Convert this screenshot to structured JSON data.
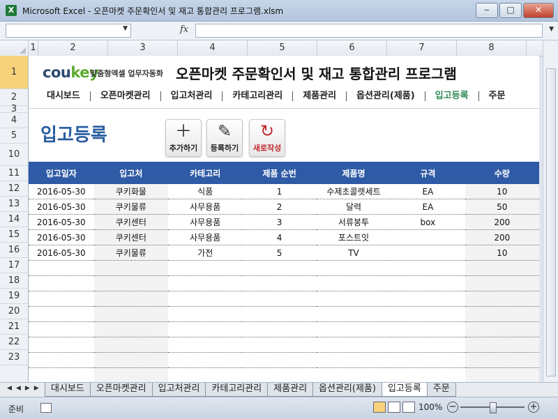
{
  "window": {
    "app_icon": "excel-icon",
    "title": "Microsoft Excel - 오픈마켓 주문확인서 및 재고 통합관리 프로그램.xlsm",
    "btn_minimize": "‒",
    "btn_maximize": "□",
    "btn_close": "✕"
  },
  "formula_bar": {
    "name_box_value": "",
    "fx_label": "fx",
    "formula_value": ""
  },
  "columns": [
    "1",
    "2",
    "3",
    "4",
    "5",
    "6",
    "7",
    "8"
  ],
  "rows": [
    "1",
    "2",
    "3",
    "4",
    "5",
    "10",
    "11",
    "12",
    "13",
    "14",
    "15",
    "16",
    "17",
    "18",
    "19",
    "20",
    "21",
    "22",
    "23"
  ],
  "header": {
    "logo_main": "cou",
    "logo_accent": "key",
    "logo_sub": "맞춤형엑셀 업무자동화",
    "app_title": "오픈마켓 주문확인서 및 재고 통합관리 프로그램"
  },
  "nav": {
    "items": [
      {
        "label": "대시보드",
        "active": false
      },
      {
        "label": "오픈마켓관리",
        "active": false
      },
      {
        "label": "입고처관리",
        "active": false
      },
      {
        "label": "카테고리관리",
        "active": false
      },
      {
        "label": "제품관리",
        "active": false
      },
      {
        "label": "옵션관리(제품)",
        "active": false
      },
      {
        "label": "입고등록",
        "active": true
      },
      {
        "label": "주문",
        "active": false
      }
    ]
  },
  "page": {
    "title": "입고등록",
    "buttons": {
      "add": {
        "label": "추가하기",
        "icon": "plus-icon"
      },
      "register": {
        "label": "등록하기",
        "icon": "pencil-icon"
      },
      "new": {
        "label": "새로작성",
        "icon": "refresh-icon"
      }
    }
  },
  "table": {
    "columns": [
      "입고일자",
      "입고처",
      "카테고리",
      "제품 순번",
      "제품명",
      "규격",
      "수량"
    ],
    "rows": [
      [
        "2016-05-30",
        "쿠키화물",
        "식품",
        "1",
        "수제초콜렛세트",
        "EA",
        "10"
      ],
      [
        "2016-05-30",
        "쿠키물류",
        "사무용품",
        "2",
        "달력",
        "EA",
        "50"
      ],
      [
        "2016-05-30",
        "쿠키센터",
        "사무용품",
        "3",
        "서류봉투",
        "box",
        "200"
      ],
      [
        "2016-05-30",
        "쿠키센터",
        "사무용품",
        "4",
        "포스트잇",
        "",
        "200"
      ],
      [
        "2016-05-30",
        "쿠키물류",
        "가전",
        "5",
        "TV",
        "",
        "10"
      ],
      [
        "",
        "",
        "",
        "",
        "",
        "",
        ""
      ],
      [
        "",
        "",
        "",
        "",
        "",
        "",
        ""
      ],
      [
        "",
        "",
        "",
        "",
        "",
        "",
        ""
      ],
      [
        "",
        "",
        "",
        "",
        "",
        "",
        ""
      ],
      [
        "",
        "",
        "",
        "",
        "",
        "",
        ""
      ],
      [
        "",
        "",
        "",
        "",
        "",
        "",
        ""
      ],
      [
        "",
        "",
        "",
        "",
        "",
        "",
        ""
      ],
      [
        "",
        "",
        "",
        "",
        "",
        "",
        ""
      ]
    ]
  },
  "sheet_tabs": {
    "items": [
      "대시보드",
      "오픈마켓관리",
      "입고처관리",
      "카테고리관리",
      "제품관리",
      "옵션관리(제품)",
      "입고등록",
      "주문"
    ],
    "active": "입고등록"
  },
  "status": {
    "text": "준비",
    "zoom": "100%",
    "zoom_minus": "−",
    "zoom_plus": "+"
  },
  "colors": {
    "table_header": "#2f5aa5",
    "page_title": "#2a5d9f",
    "nav_active": "#2e8b57",
    "row_header_active": "#f6d27a"
  }
}
